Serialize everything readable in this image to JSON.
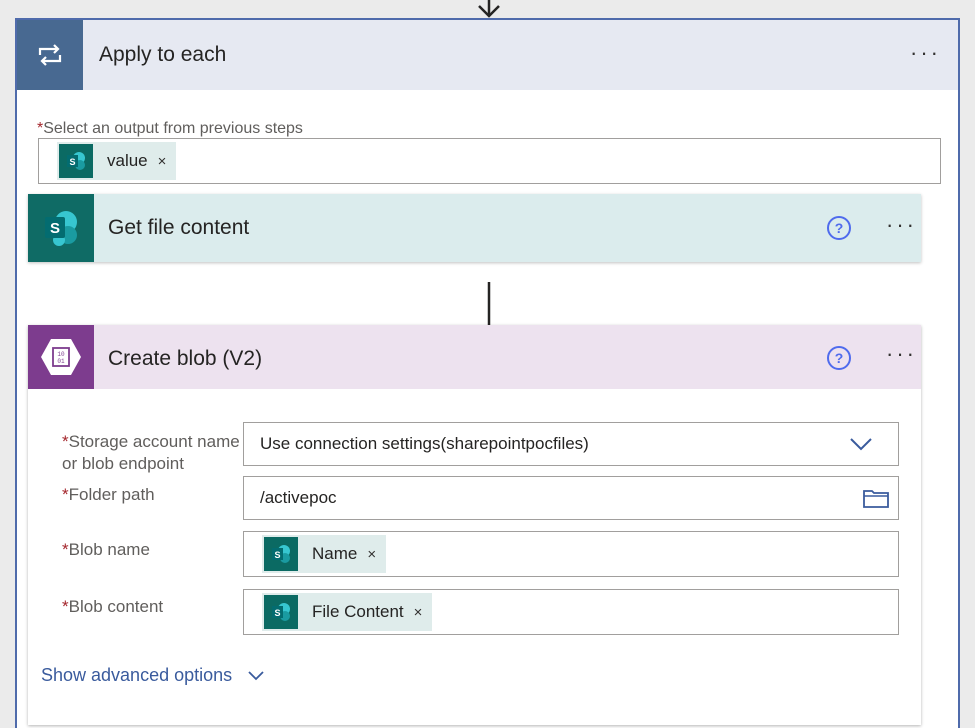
{
  "apply_each": {
    "title": "Apply to each",
    "more": "···",
    "output_label": "Select an output from previous steps",
    "output_token": "value",
    "token_remove": "×"
  },
  "get_file": {
    "title": "Get file content",
    "help": "?",
    "more": "···"
  },
  "create_blob": {
    "title": "Create blob (V2)",
    "help": "?",
    "more": "···",
    "fields": {
      "storage_label_line1": "Storage account name",
      "storage_label_line2": "or blob endpoint",
      "storage_value": "Use connection settings(sharepointpocfiles)",
      "folder_label": "Folder path",
      "folder_value": "/activepoc",
      "blob_name_label": "Blob name",
      "blob_name_token": "Name",
      "blob_content_label": "Blob content",
      "blob_content_token": "File Content"
    },
    "required_mark": "*",
    "token_remove": "×",
    "show_advanced": "Show advanced options"
  },
  "colors": {
    "loop_header": "#486991",
    "sharepoint": "#0b6a63",
    "blob": "#7d3c8e",
    "link": "#3a5b9d",
    "help": "#4f6bed"
  },
  "icons": [
    "loop-icon",
    "sharepoint-icon",
    "blob-storage-icon",
    "help-icon",
    "more-icon",
    "chevron-down-icon",
    "folder-icon",
    "remove-icon",
    "arrow-down-icon"
  ]
}
